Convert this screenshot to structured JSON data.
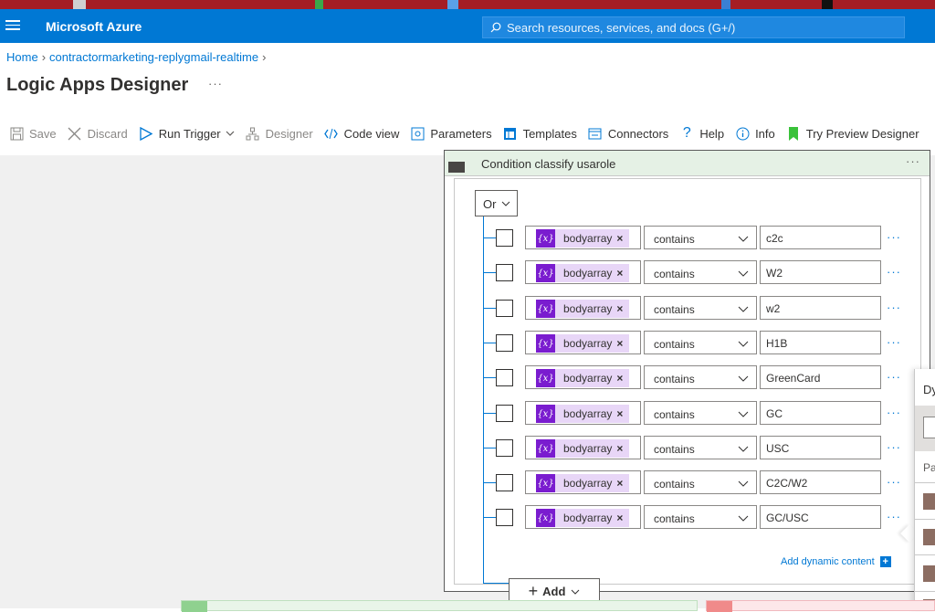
{
  "portal": {
    "brand": "Microsoft Azure",
    "search_placeholder": "Search resources, services, and docs (G+/)"
  },
  "breadcrumb": {
    "home": "Home",
    "resource": "contractormarketing-replygmail-realtime"
  },
  "page": {
    "title": "Logic Apps Designer",
    "more": "···"
  },
  "toolbar": {
    "save": "Save",
    "discard": "Discard",
    "run_trigger": "Run Trigger",
    "designer": "Designer",
    "code_view": "Code view",
    "parameters": "Parameters",
    "templates": "Templates",
    "connectors": "Connectors",
    "help": "Help",
    "info": "Info",
    "try_preview": "Try Preview Designer"
  },
  "condition": {
    "title": "Condition classify usarole",
    "more": "···",
    "group_operator": "Or",
    "rows": [
      {
        "token_icon": "{x}",
        "token": "bodyarray",
        "remove": "×",
        "operator": "contains",
        "value": "c2c",
        "more": "···"
      },
      {
        "token_icon": "{x}",
        "token": "bodyarray",
        "remove": "×",
        "operator": "contains",
        "value": "W2",
        "more": "···"
      },
      {
        "token_icon": "{x}",
        "token": "bodyarray",
        "remove": "×",
        "operator": "contains",
        "value": "w2",
        "more": "···"
      },
      {
        "token_icon": "{x}",
        "token": "bodyarray",
        "remove": "×",
        "operator": "contains",
        "value": "H1B",
        "more": "···"
      },
      {
        "token_icon": "{x}",
        "token": "bodyarray",
        "remove": "×",
        "operator": "contains",
        "value": "GreenCard",
        "more": "···"
      },
      {
        "token_icon": "{x}",
        "token": "bodyarray",
        "remove": "×",
        "operator": "contains",
        "value": "GC",
        "more": "···"
      },
      {
        "token_icon": "{x}",
        "token": "bodyarray",
        "remove": "×",
        "operator": "contains",
        "value": "USC",
        "more": "···"
      },
      {
        "token_icon": "{x}",
        "token": "bodyarray",
        "remove": "×",
        "operator": "contains",
        "value": "C2C/W2",
        "more": "···"
      },
      {
        "token_icon": "{x}",
        "token": "bodyarray",
        "remove": "×",
        "operator": "contains",
        "value": "GC/USC",
        "more": "···"
      }
    ],
    "add_dynamic_content": "Add dynamic content",
    "add_dynamic_plus": "+",
    "add_button": "Add",
    "add_plus": "+"
  },
  "dynamic_panel": {
    "title_partial": "Dy",
    "section_partial": "Pa"
  },
  "colors": {
    "azure_blue": "#0078d4",
    "token_purple": "#7a1ccf",
    "token_bg": "#e8d6f7",
    "condition_header": "#e5f1e5"
  }
}
